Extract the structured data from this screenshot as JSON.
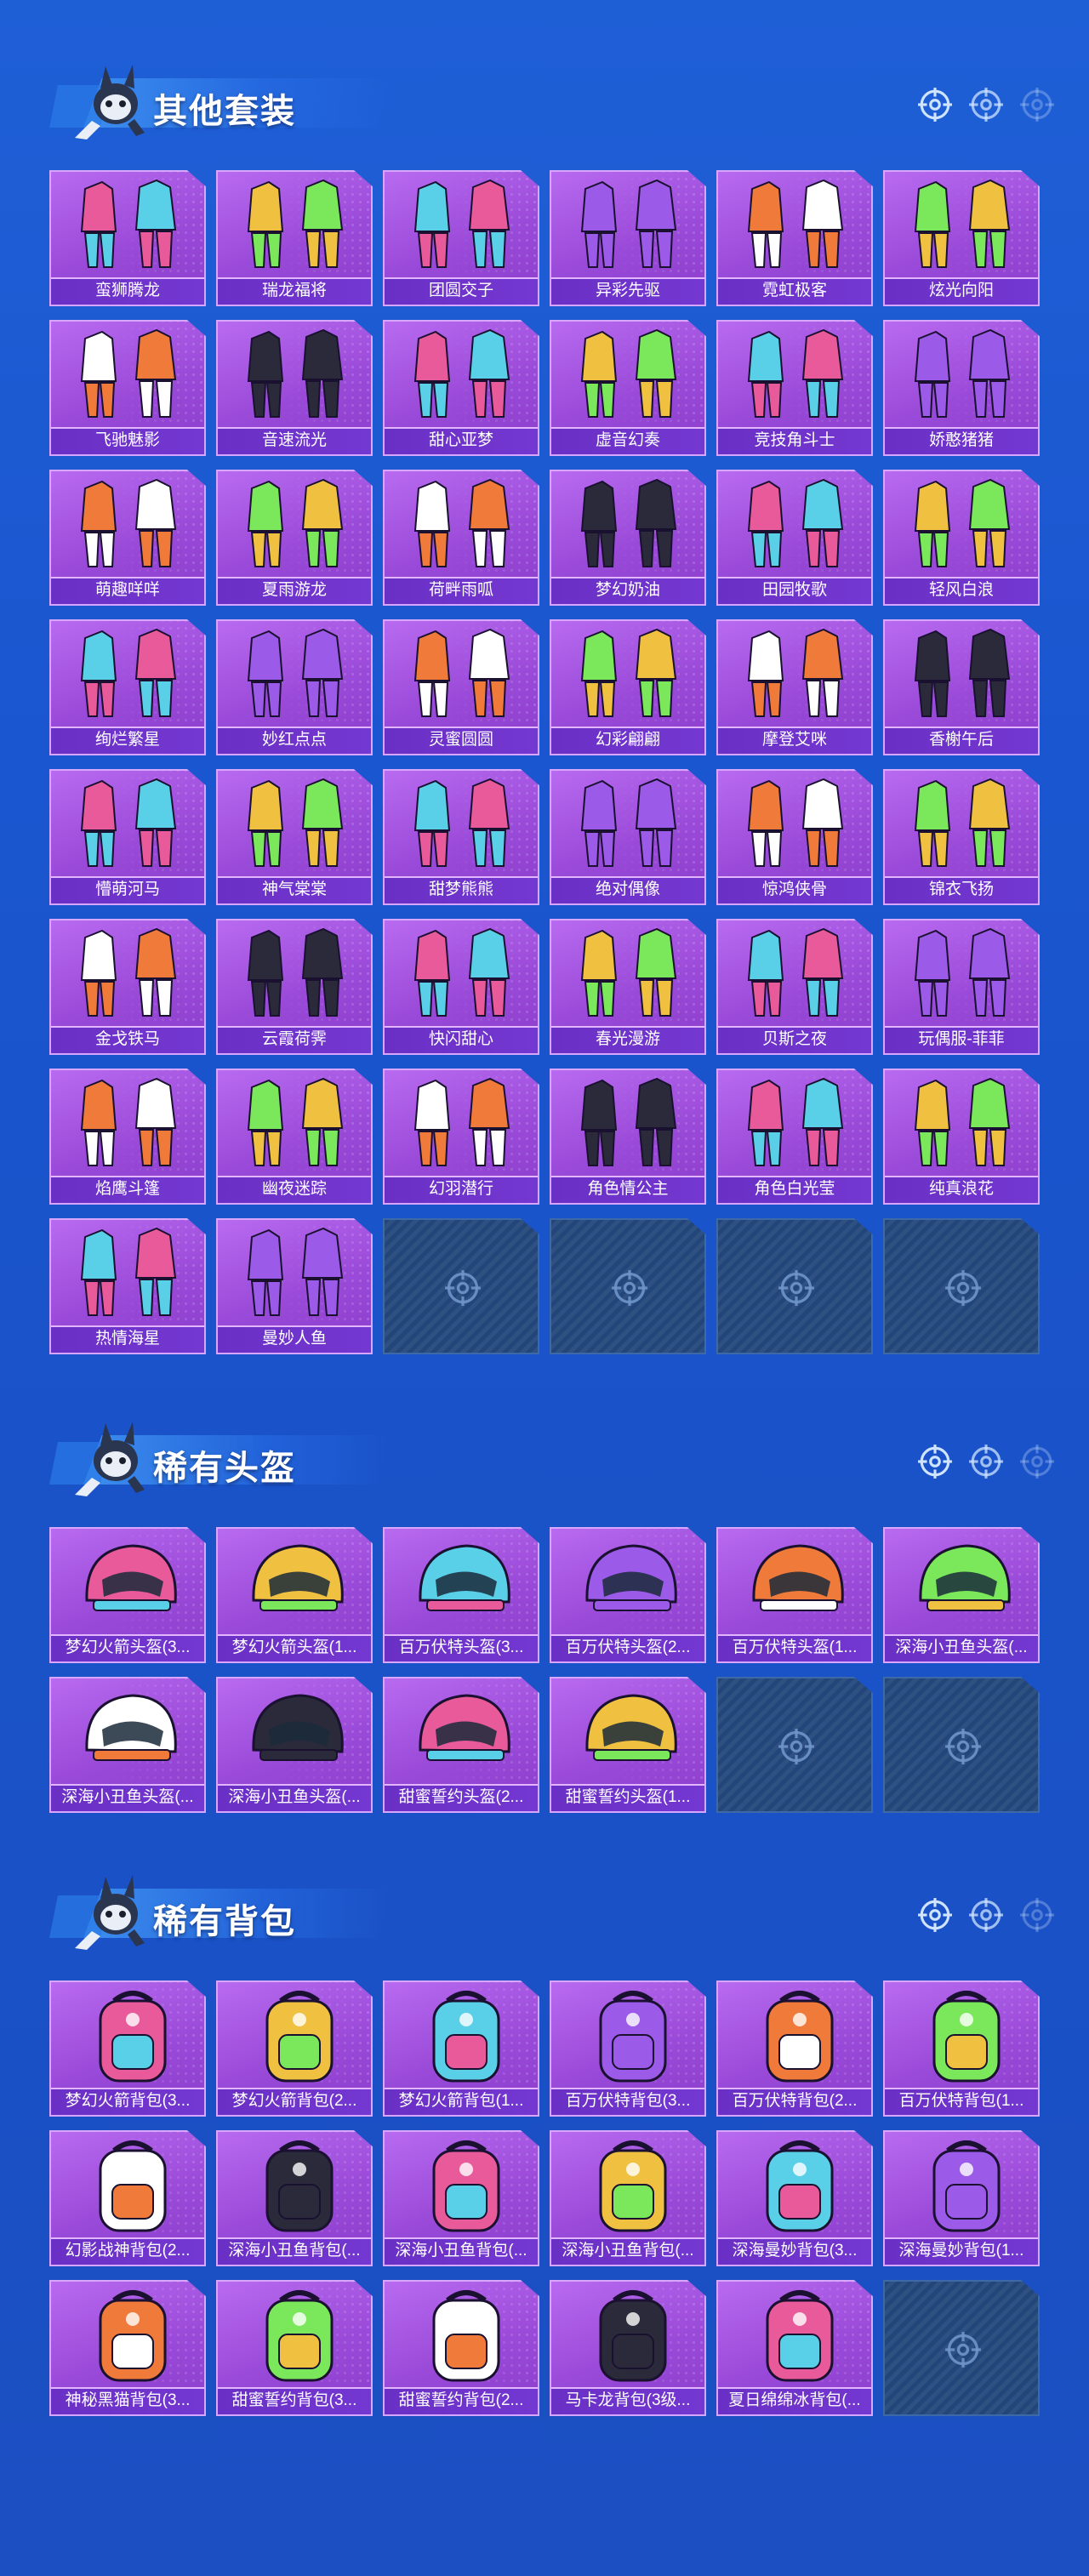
{
  "sections": [
    {
      "title": "其他套装",
      "items": [
        "蛮狮腾龙",
        "瑞龙福将",
        "团圆交子",
        "异彩先驱",
        "霓虹极客",
        "炫光向阳",
        "飞驰魅影",
        "音速流光",
        "甜心亚梦",
        "虚音幻奏",
        "竞技角斗士",
        "娇憨猪猪",
        "萌趣咩咩",
        "夏雨游龙",
        "荷畔雨呱",
        "梦幻奶油",
        "田园牧歌",
        "轻风白浪",
        "绚烂繁星",
        "妙红点点",
        "灵蜜圆圆",
        "幻彩翩翩",
        "摩登艾咪",
        "香榭午后",
        "懵萌河马",
        "神气棠棠",
        "甜梦熊熊",
        "绝对偶像",
        "惊鸿侠骨",
        "锦衣飞扬",
        "金戈铁马",
        "云霞荷霁",
        "快闪甜心",
        "春光漫游",
        "贝斯之夜",
        "玩偶服-菲菲",
        "焰鹰斗篷",
        "幽夜迷踪",
        "幻羽潜行",
        "角色情公主",
        "角色白光莹",
        "纯真浪花",
        "热情海星",
        "曼妙人鱼"
      ],
      "empty_slots": 4
    },
    {
      "title": "稀有头盔",
      "items": [
        "梦幻火箭头盔(3...",
        "梦幻火箭头盔(1...",
        "百万伏特头盔(3...",
        "百万伏特头盔(2...",
        "百万伏特头盔(1...",
        "深海小丑鱼头盔(...",
        "深海小丑鱼头盔(...",
        "深海小丑鱼头盔(...",
        "甜蜜誓约头盔(2...",
        "甜蜜誓约头盔(1..."
      ],
      "empty_slots": 2
    },
    {
      "title": "稀有背包",
      "items": [
        "梦幻火箭背包(3...",
        "梦幻火箭背包(2...",
        "梦幻火箭背包(1...",
        "百万伏特背包(3...",
        "百万伏特背包(2...",
        "百万伏特背包(1...",
        "幻影战神背包(2...",
        "深海小丑鱼背包(...",
        "深海小丑鱼背包(...",
        "深海小丑鱼背包(...",
        "深海曼妙背包(3...",
        "深海曼妙背包(1...",
        "神秘黑猫背包(3...",
        "甜蜜誓约背包(3...",
        "甜蜜誓约背包(2...",
        "马卡龙背包(3级...",
        "夏日绵绵冰背包(..."
      ],
      "empty_slots": 1
    }
  ],
  "icons": {
    "section_mascot": "mascot-icon",
    "crosshair": "crosshair-icon"
  },
  "colors": {
    "background": "#1f5fd6",
    "card_purple": "#9a4ad8",
    "card_label": "#6a2fc4",
    "empty_slot": "#22467a"
  }
}
